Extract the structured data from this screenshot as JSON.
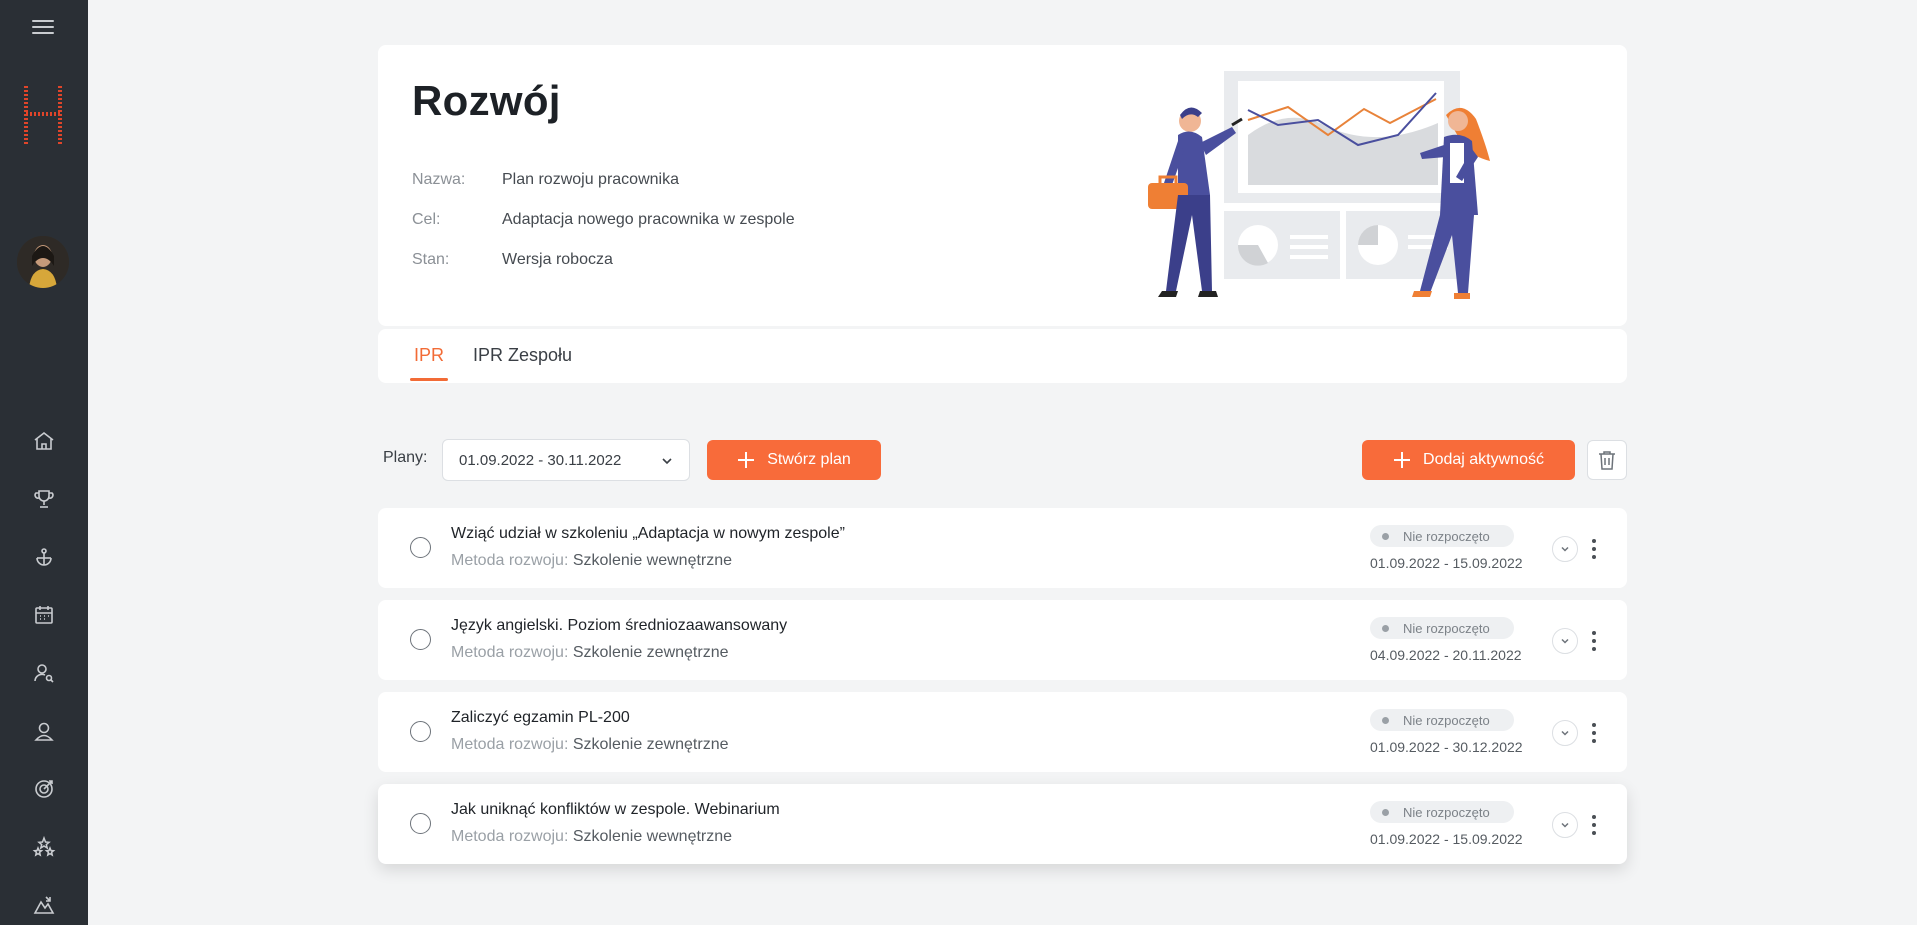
{
  "sidebar": {
    "menu_icon": "hamburger-icon",
    "logo": "H",
    "nav_icons": [
      "home-icon",
      "trophy-icon",
      "ship-wheel-icon",
      "calendar-icon",
      "user-search-icon",
      "user-icon",
      "target-icon",
      "stars-icon",
      "chart-mountain-icon"
    ]
  },
  "header": {
    "title": "Rozwój",
    "fields": [
      {
        "label": "Nazwa:",
        "value": "Plan rozwoju pracownika"
      },
      {
        "label": "Cel:",
        "value": "Adaptacja nowego pracownika w zespole"
      },
      {
        "label": "Stan:",
        "value": "Wersja robocza"
      }
    ]
  },
  "tabs": [
    {
      "label": "IPR",
      "active": true
    },
    {
      "label": "IPR Zespołu",
      "active": false
    }
  ],
  "toolbar": {
    "plans_label": "Plany:",
    "plans_value": "01.09.2022 - 30.11.2022",
    "create_label": "Stwórz plan",
    "add_label": "Dodaj aktywność",
    "trash_icon": "trash-icon"
  },
  "activities": [
    {
      "title": "Wziąć udział w szkoleniu „Adaptacja w nowym zespole”",
      "method_label": "Metoda rozwoju:",
      "method": "Szkolenie wewnętrzne",
      "status": "Nie rozpoczęto",
      "dates": "01.09.2022 - 15.09.2022"
    },
    {
      "title": "Język angielski. Poziom średniozaawansowany",
      "method_label": "Metoda rozwoju:",
      "method": "Szkolenie zewnętrzne",
      "status": "Nie rozpoczęto",
      "dates": "04.09.2022 - 20.11.2022"
    },
    {
      "title": "Zaliczyć egzamin PL-200",
      "method_label": "Metoda rozwoju:",
      "method": "Szkolenie zewnętrzne",
      "status": "Nie rozpoczęto",
      "dates": "01.09.2022 - 30.12.2022"
    },
    {
      "title": "Jak uniknąć konfliktów w zespole. Webinarium",
      "method_label": "Metoda rozwoju:",
      "method": "Szkolenie wewnętrzne",
      "status": "Nie rozpoczęto",
      "dates": "01.09.2022 - 15.09.2022"
    }
  ],
  "colors": {
    "accent": "#f86b3a",
    "sidebar": "#2a2f35",
    "background": "#f3f4f5",
    "illustration_primary": "#4a4f9e"
  }
}
